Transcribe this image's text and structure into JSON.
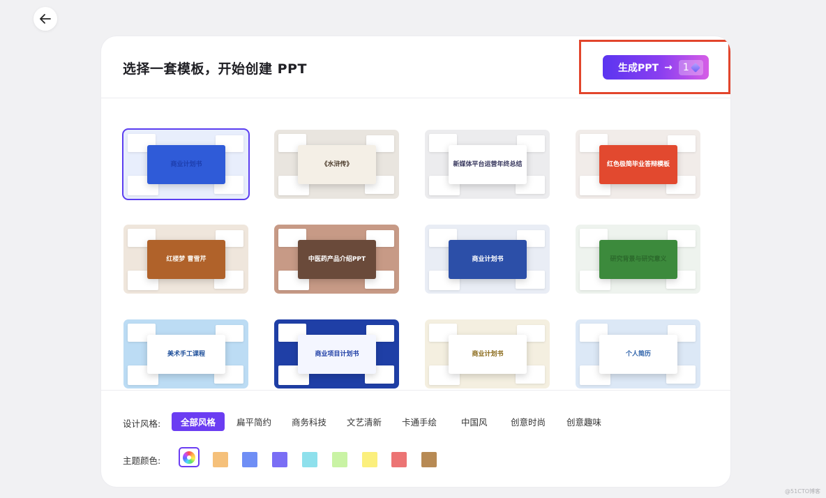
{
  "header": {
    "title": "选择一套模板，开始创建 PPT",
    "generate_label": "生成PPT",
    "generate_arrow": "→",
    "credit_count": "1"
  },
  "templates": [
    {
      "label": "商业计划书",
      "bg": "#e8eefc",
      "accent": "#2f5bd8",
      "text": "#1e3fae"
    },
    {
      "label": "《水浒传》",
      "bg": "#e9e5df",
      "accent": "#f4efe6",
      "text": "#4a3a2a"
    },
    {
      "label": "新媒体平台运营年终总结",
      "bg": "#ececee",
      "accent": "#ffffff",
      "text": "#3a3a60"
    },
    {
      "label": "红色极简毕业答辩模板",
      "bg": "#f1ece9",
      "accent": "#e2492f",
      "text": "#ffffff"
    },
    {
      "label": "红楼梦 曹雪芹",
      "bg": "#efe6dc",
      "accent": "#b0622a",
      "text": "#f7efe6"
    },
    {
      "label": "中医药产品介绍PPT",
      "bg": "#c79a86",
      "accent": "#6a4a3a",
      "text": "#ffffff"
    },
    {
      "label": "商业计划书",
      "bg": "#e9edf5",
      "accent": "#2c4fa8",
      "text": "#ffffff"
    },
    {
      "label": "研究背景与研究意义",
      "bg": "#eef3ee",
      "accent": "#3c8a3c",
      "text": "#2c6a2c"
    },
    {
      "label": "美术手工课程",
      "bg": "#bcdcf4",
      "accent": "#ffffff",
      "text": "#1e4f9a"
    },
    {
      "label": "商业项目计划书",
      "bg": "#1f3fa6",
      "accent": "#f4f6ff",
      "text": "#1f3fa6"
    },
    {
      "label": "商业计划书",
      "bg": "#f4efe0",
      "accent": "#ffffff",
      "text": "#8a6a1a"
    },
    {
      "label": "个人简历",
      "bg": "#dce8f6",
      "accent": "#ffffff",
      "text": "#2a5fa8"
    }
  ],
  "filters": {
    "style_label": "设计风格:",
    "styles": [
      "全部风格",
      "扁平简约",
      "商务科技",
      "文艺清新",
      "卡通手绘",
      "中国风",
      "创意时尚",
      "创意趣味"
    ],
    "active_style": "全部风格",
    "color_label": "主题颜色:",
    "colors": [
      "#f5c07a",
      "#6f8ef5",
      "#7a6ef5",
      "#8ee0ec",
      "#c9f3a4",
      "#fbef7d",
      "#ec7474",
      "#b78a54"
    ]
  },
  "watermark": "@51CTO博客"
}
